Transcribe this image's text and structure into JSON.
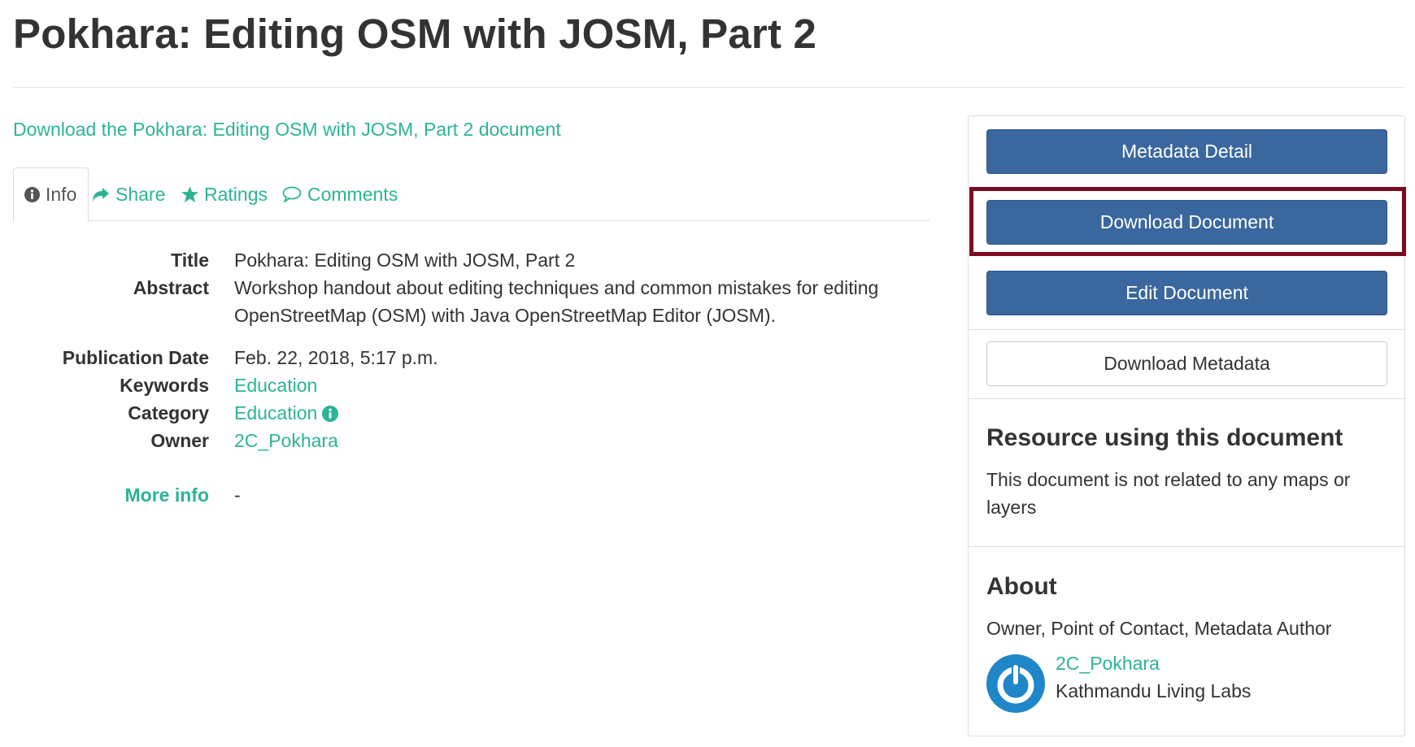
{
  "page_title": "Pokhara: Editing OSM with JOSM, Part 2",
  "download_link": "Download the Pokhara: Editing OSM with JOSM, Part 2 document",
  "tabs": [
    {
      "label": "Info",
      "icon": "info-circle-icon",
      "active": true
    },
    {
      "label": "Share",
      "icon": "share-icon",
      "active": false
    },
    {
      "label": "Ratings",
      "icon": "star-icon",
      "active": false
    },
    {
      "label": "Comments",
      "icon": "comment-icon",
      "active": false
    }
  ],
  "info": {
    "title_key": "Title",
    "title_val": "Pokhara: Editing OSM with JOSM, Part 2",
    "abstract_key": "Abstract",
    "abstract_line1": "Workshop handout about editing techniques and common mistakes for editing",
    "abstract_line2": "OpenStreetMap (OSM) with Java OpenStreetMap Editor (JOSM).",
    "pubdate_key": "Publication Date",
    "pubdate_val": "Feb. 22, 2018, 5:17 p.m.",
    "keywords_key": "Keywords",
    "keywords_val": "Education",
    "category_key": "Category",
    "category_val": "Education",
    "owner_key": "Owner",
    "owner_val": "2C_Pokhara",
    "more_info_key": "More info",
    "more_info_val": "-"
  },
  "sidebar": {
    "metadata_detail": "Metadata Detail",
    "download_document": "Download Document",
    "edit_document": "Edit Document",
    "download_metadata": "Download Metadata",
    "resource_heading": "Resource using this document",
    "resource_text": "This document is not related to any maps or layers",
    "about_heading": "About",
    "about_roles": "Owner, Point of Contact, Metadata Author",
    "owner_name": "2C_Pokhara",
    "owner_org": "Kathmandu Living Labs"
  },
  "colors": {
    "accent_link": "#2cb495",
    "primary_button": "#3a679e",
    "highlight_border": "#7d0a1e"
  }
}
